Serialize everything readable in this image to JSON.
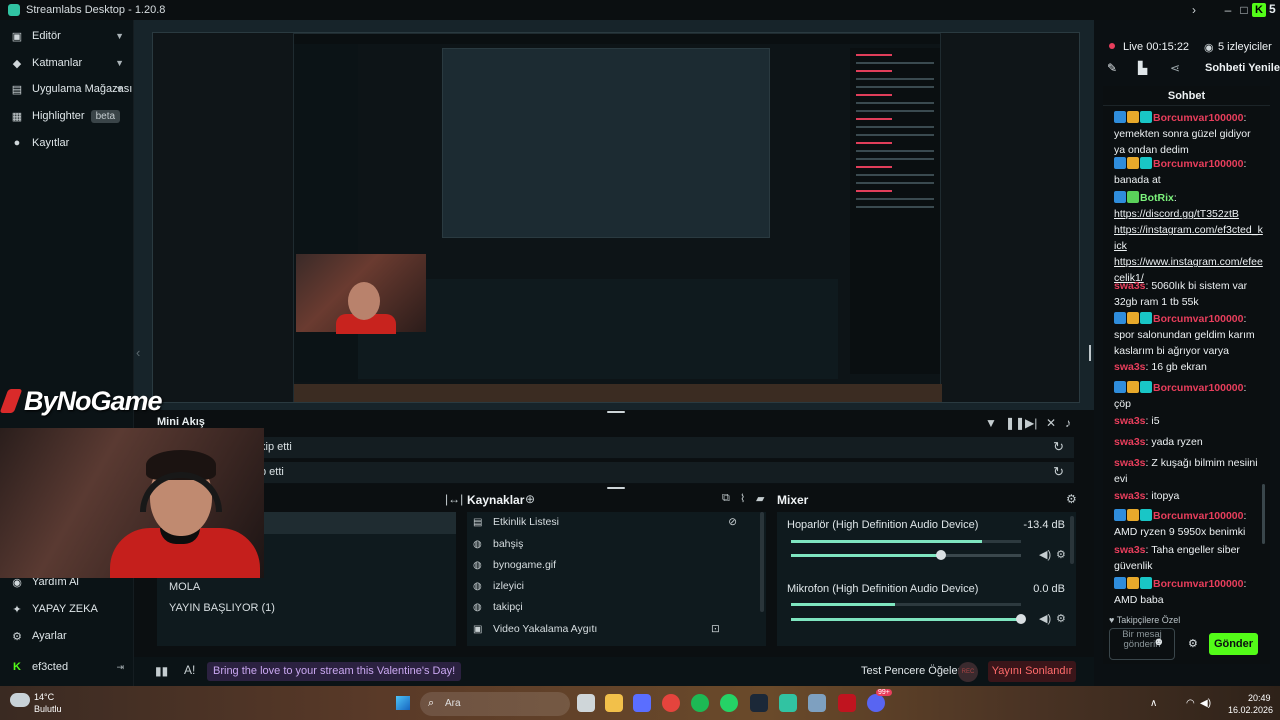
{
  "app": {
    "title": "Streamlabs Desktop - 1.20.8",
    "kick_count": "5",
    "kick_letter": "K"
  },
  "sidebar": {
    "items": [
      {
        "label": "Editör",
        "icon": "editor-icon"
      },
      {
        "label": "Katmanlar",
        "icon": "layers-icon"
      },
      {
        "label": "Uygulama Mağazası",
        "icon": "store-icon"
      },
      {
        "label": "Highlighter",
        "icon": "highlighter-icon",
        "badge": "beta"
      },
      {
        "label": "Kayıtlar",
        "icon": "recordings-icon"
      }
    ],
    "bottom": [
      {
        "label": "Yardım Al",
        "icon": "help-icon"
      },
      {
        "label": "YAPAY ZEKA",
        "icon": "ai-icon"
      },
      {
        "label": "Ayarlar",
        "icon": "settings-icon"
      },
      {
        "label": "ef3cted",
        "icon": "kick-icon"
      }
    ]
  },
  "brand": {
    "name": "ByNoGame"
  },
  "scenes": {
    "mini_label": "Mini Akış",
    "row1": "kip etti",
    "row2": "p etti",
    "items": [
      "MOLA",
      "YAYIN BAŞLIYOR (1)"
    ]
  },
  "sources": {
    "title": "Kaynaklar",
    "items": [
      "Etkinlik Listesi",
      "bahşiş",
      "bynogame.gif",
      "izleyici",
      "takipçi",
      "Video Yakalama Aygıtı"
    ]
  },
  "mixer": {
    "title": "Mixer",
    "channels": [
      {
        "name": "Hoparlör (High Definition Audio Device)",
        "db": "-13.4 dB",
        "level": 0.83,
        "volume": 0.65
      },
      {
        "name": "Mikrofon (High Definition Audio Device)",
        "db": "0.0 dB",
        "level": 0.45,
        "volume": 1.0
      }
    ]
  },
  "footer": {
    "banner": "Bring the love to your stream this Valentine's Day!",
    "test_widgets": "Test Pencere Öğeleri",
    "rec": "REC",
    "end_stream": "Yayını Sonlandır"
  },
  "live": {
    "status": "Live 00:15:22",
    "viewers": "5 izleyiciler",
    "refresh_chat": "Sohbeti Yenile"
  },
  "chat": {
    "title": "Sohbet",
    "messages": [
      {
        "user": "Borcumvar100000",
        "text": "yemekten sonra güzel gidiyor ya ondan dedim",
        "color": "#e83e5c"
      },
      {
        "user": "Borcumvar100000",
        "text": "banada at",
        "color": "#e83e5c"
      },
      {
        "user": "BotRix",
        "text": "",
        "color": "#7cf27c",
        "links": [
          "https://discord.gg/tT352ztB",
          "https://instagram.com/ef3cted_kick",
          "https://www.instagram.com/efeecelik1/"
        ]
      },
      {
        "user": "swa3s",
        "text": "5060lık bi sistem var 32gb ram 1 tb 55k",
        "color": "#e83e5c"
      },
      {
        "user": "Borcumvar100000",
        "text": "spor salonundan geldim karım kaslarım bi ağrıyor varya",
        "color": "#e83e5c"
      },
      {
        "user": "swa3s",
        "text": "16 gb ekran",
        "color": "#e83e5c"
      },
      {
        "user": "Borcumvar100000",
        "text": "çöp",
        "color": "#e83e5c"
      },
      {
        "user": "swa3s",
        "text": "i5",
        "color": "#e83e5c"
      },
      {
        "user": "swa3s",
        "text": "yada ryzen",
        "color": "#e83e5c"
      },
      {
        "user": "swa3s",
        "text": "Z kuşağı bilmim nesiini evi",
        "color": "#e83e5c"
      },
      {
        "user": "swa3s",
        "text": "itopya",
        "color": "#e83e5c"
      },
      {
        "user": "Borcumvar100000",
        "text": "AMD ryzen 9 5950x benimki",
        "color": "#e83e5c"
      },
      {
        "user": "swa3s",
        "text": "Taha engeller siber güvenlik",
        "color": "#e83e5c"
      },
      {
        "user": "Borcumvar100000",
        "text": "AMD baba",
        "color": "#e83e5c"
      }
    ],
    "followers_only": "Takipçilere Özel",
    "input_placeholder": "Bir mesaj gönderin",
    "send": "Gönder"
  },
  "taskbar": {
    "weather_temp": "14°C",
    "weather_desc": "Bulutlu",
    "search": "Ara",
    "time": "20:49",
    "date": "16.02.2026",
    "notification_count": "99+"
  }
}
